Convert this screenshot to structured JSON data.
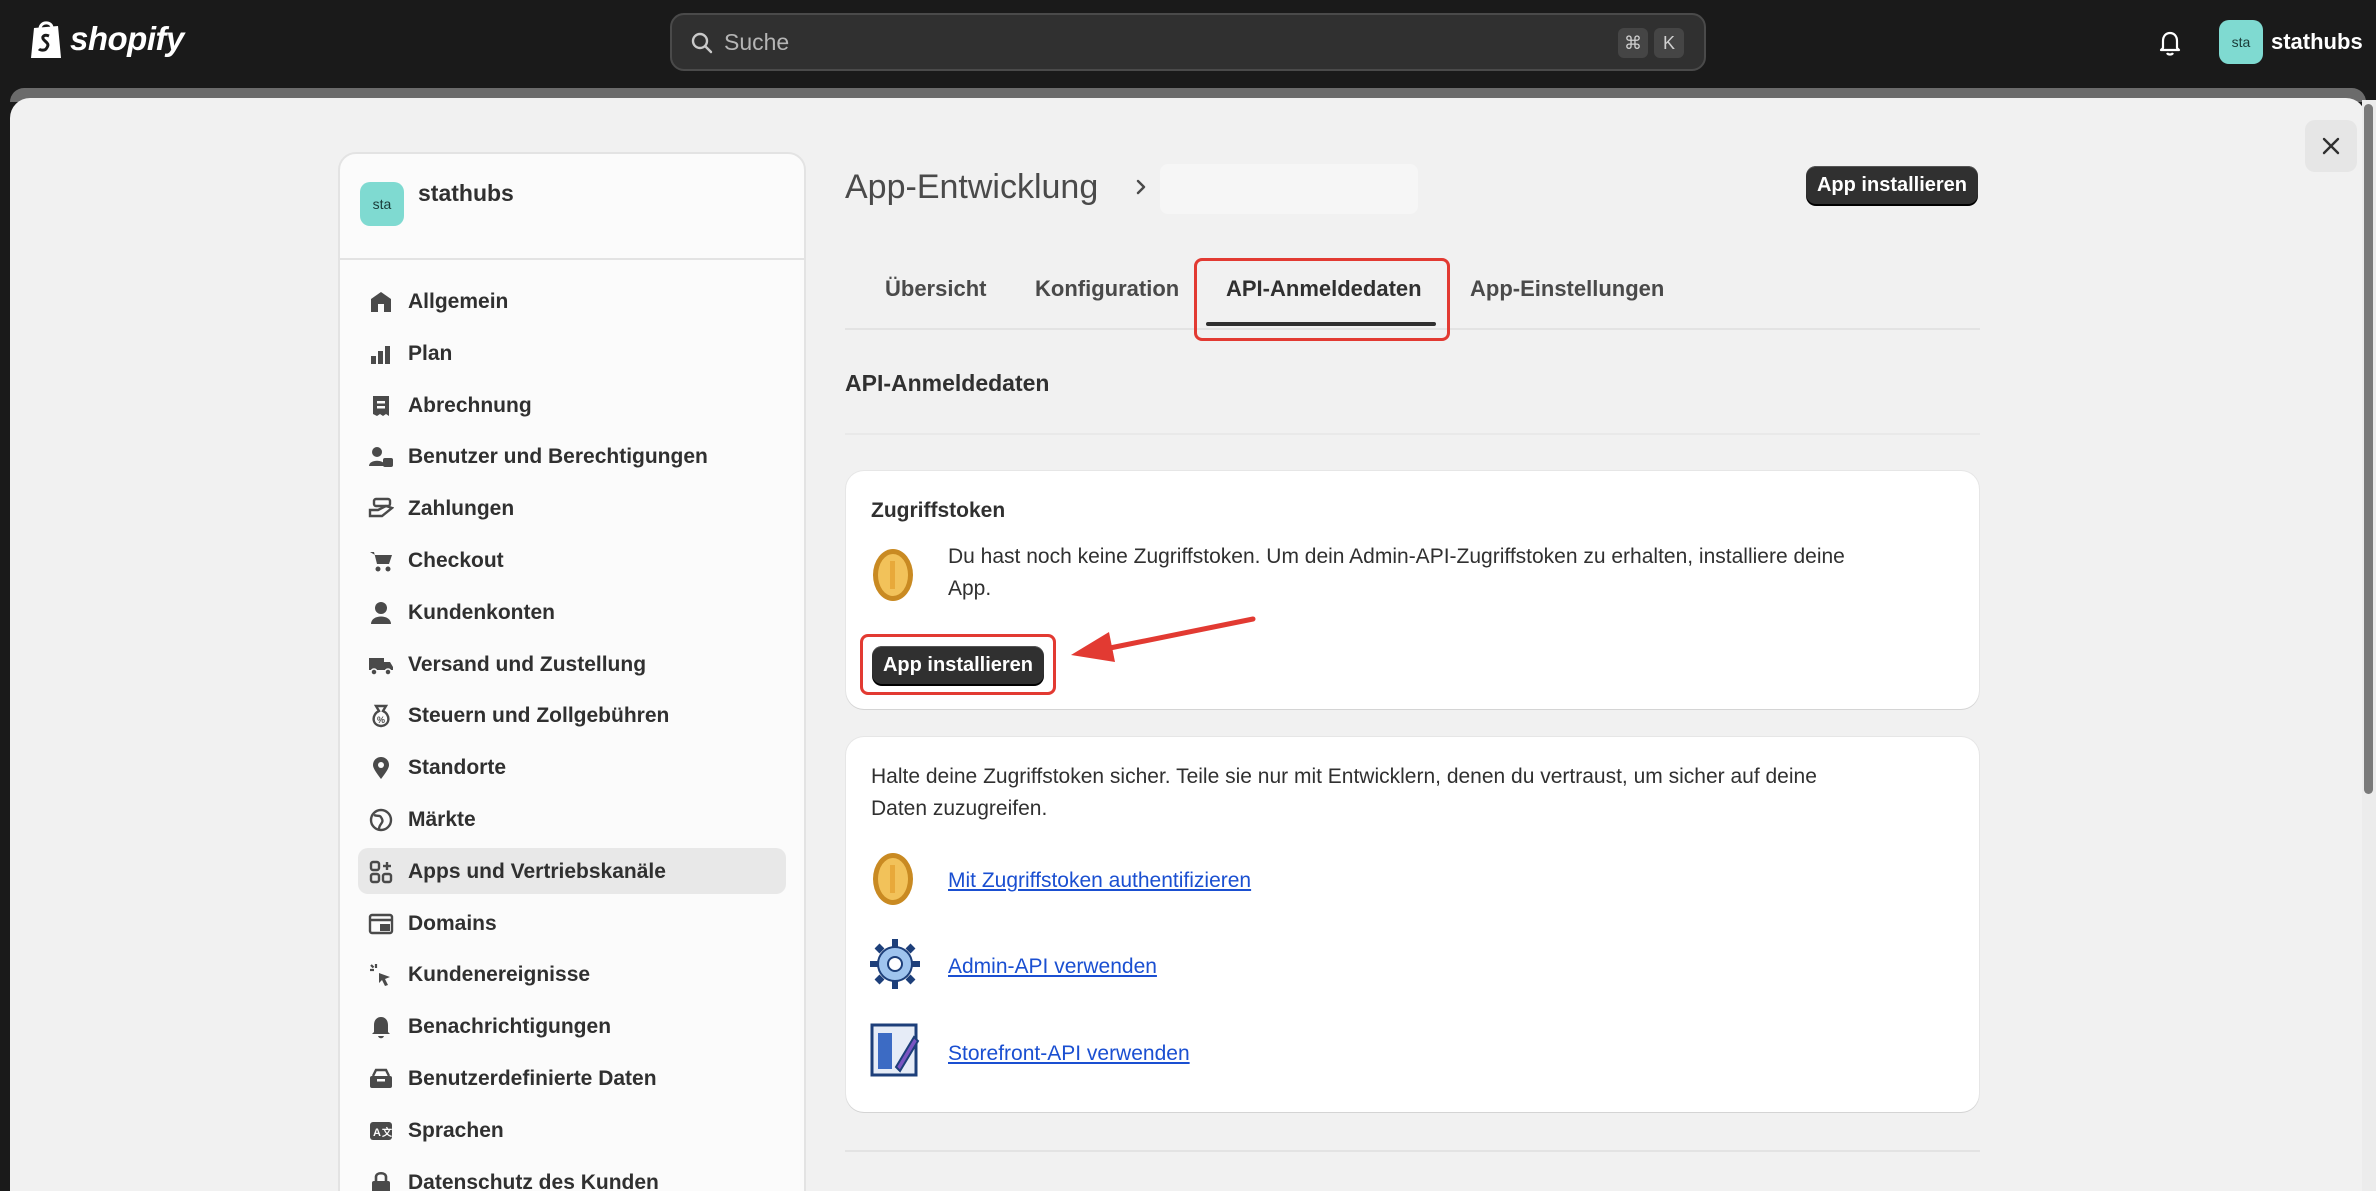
{
  "topbar": {
    "brand": "shopify",
    "search_placeholder": "Suche",
    "shortcut_cmd": "⌘",
    "shortcut_key": "K",
    "avatar_initials": "sta",
    "store_name": "stathubs"
  },
  "sidebar": {
    "avatar_initials": "sta",
    "store_name": "stathubs",
    "items": [
      {
        "label": "Allgemein",
        "icon": "store-icon"
      },
      {
        "label": "Plan",
        "icon": "plan-icon"
      },
      {
        "label": "Abrechnung",
        "icon": "receipt-icon"
      },
      {
        "label": "Benutzer und Berechtigungen",
        "icon": "users-lock-icon"
      },
      {
        "label": "Zahlungen",
        "icon": "payment-hand-icon"
      },
      {
        "label": "Checkout",
        "icon": "cart-icon"
      },
      {
        "label": "Kundenkonten",
        "icon": "person-icon"
      },
      {
        "label": "Versand und Zustellung",
        "icon": "truck-icon"
      },
      {
        "label": "Steuern und Zollgebühren",
        "icon": "tax-bag-icon"
      },
      {
        "label": "Standorte",
        "icon": "location-pin-icon"
      },
      {
        "label": "Märkte",
        "icon": "globe-icon"
      },
      {
        "label": "Apps und Vertriebskanäle",
        "icon": "apps-icon"
      },
      {
        "label": "Domains",
        "icon": "domain-icon"
      },
      {
        "label": "Kundenereignisse",
        "icon": "cursor-click-icon"
      },
      {
        "label": "Benachrichtigungen",
        "icon": "bell-icon"
      },
      {
        "label": "Benutzerdefinierte Daten",
        "icon": "database-icon"
      },
      {
        "label": "Sprachen",
        "icon": "language-icon"
      },
      {
        "label": "Datenschutz des Kunden",
        "icon": "privacy-lock-icon"
      }
    ],
    "active_index": 11
  },
  "main": {
    "breadcrumb_title": "App-Entwicklung",
    "install_button": "App installieren",
    "tabs": [
      "Übersicht",
      "Konfiguration",
      "API-Anmeldedaten",
      "App-Einstellungen"
    ],
    "active_tab": 2,
    "section_title": "API-Anmeldedaten",
    "token_card": {
      "title": "Zugriffstoken",
      "text_line1": "Du hast noch keine Zugriffstoken. Um dein Admin-API-Zugriffstoken zu erhalten, installiere deine",
      "text_line2": "App.",
      "button": "App installieren"
    },
    "info_card": {
      "text_line1": "Halte deine Zugriffstoken sicher. Teile sie nur mit Entwicklern, denen du vertraust, um sicher auf deine",
      "text_line2": "Daten zuzugreifen.",
      "links": [
        {
          "label": "Mit Zugriffstoken authentifizieren",
          "icon": "coin-icon"
        },
        {
          "label": "Admin-API verwenden",
          "icon": "gear-icon"
        },
        {
          "label": "Storefront-API verwenden",
          "icon": "storefront-doc-icon"
        }
      ]
    }
  },
  "colors": {
    "topbar": "#1a1a1a",
    "avatar": "#7fdad1",
    "highlight": "#e23a32",
    "link": "#1a4fd1",
    "button_dark": "#303030"
  }
}
